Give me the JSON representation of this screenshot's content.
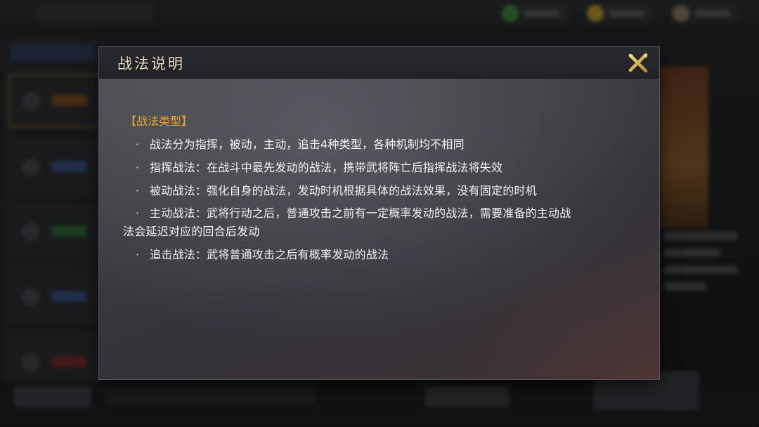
{
  "dialog": {
    "title": "战法说明",
    "close_icon": "close-x-icon",
    "accent_color": "#e8a437",
    "section": {
      "heading": "【战法类型】",
      "bullet": "·",
      "rules": [
        "战法分为指挥，被动，主动，追击4种类型，各种机制均不相同",
        "指挥战法：在战斗中最先发动的战法，携带武将阵亡后指挥战法将失效",
        "被动战法：强化自身的战法，发动时机根据具体的战法效果，没有固定的时机",
        {
          "line1": "主动战法：武将行动之后，普通攻击之前有一定概率发动的战法，需要准备的主动战",
          "line2": "法会延迟对应的回合后发动"
        },
        "追击战法：武将普通攻击之后有概率发动的战法"
      ]
    }
  }
}
